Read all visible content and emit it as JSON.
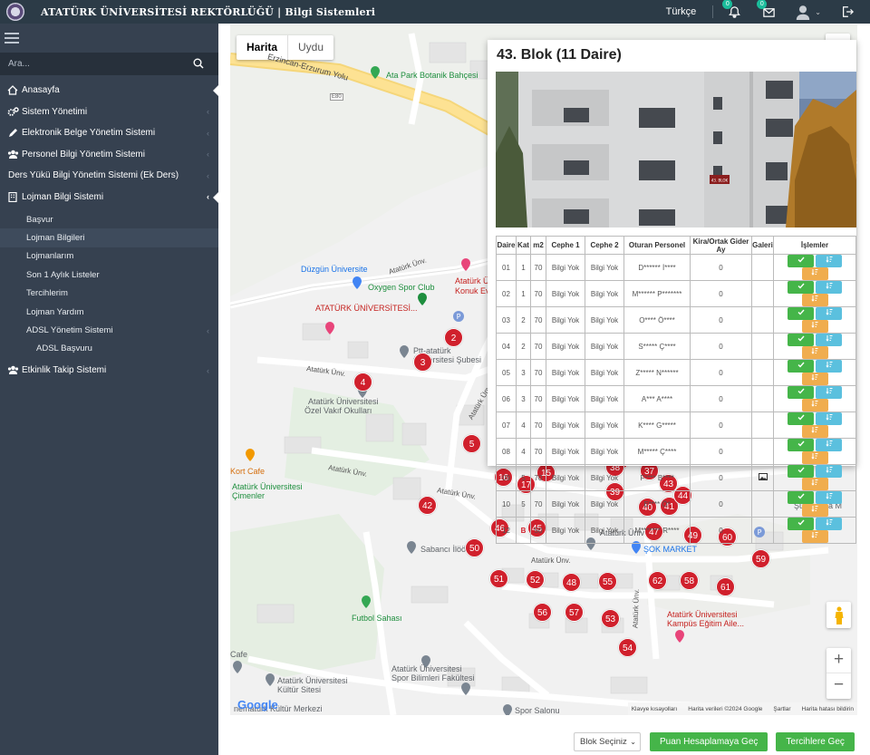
{
  "header": {
    "brand": "ATATÜRK ÜNİVERSİTESİ REKTÖRLÜĞÜ | Bilgi Sistemleri",
    "language": "Türkçe",
    "notifications_badge": "0",
    "messages_badge": "0"
  },
  "sidebar": {
    "search_placeholder": "Ara...",
    "items": [
      {
        "label": "Anasayfa",
        "icon": "home-icon"
      },
      {
        "label": "Sistem Yönetimi",
        "icon": "cogs-icon"
      },
      {
        "label": "Elektronik Belge Yönetim Sistemi",
        "icon": "pencil-icon"
      },
      {
        "label": "Personel Bilgi Yönetim Sistemi",
        "icon": "users-icon"
      },
      {
        "label": "Ders Yükü Bilgi Yönetim Sistemi (Ek Ders)",
        "icon": ""
      },
      {
        "label": "Lojman Bilgi Sistemi",
        "icon": "building-icon"
      }
    ],
    "subitems": [
      "Başvur",
      "Lojman Bilgileri",
      "Lojmanlarım",
      "Son 1 Aylık Listeler",
      "Tercihlerim",
      "Lojman Yardım",
      "ADSL Yönetim Sistemi",
      "ADSL Başvuru"
    ],
    "last_item": {
      "label": "Etkinlik Takip Sistemi",
      "icon": "users-icon"
    }
  },
  "map": {
    "type_map": "Harita",
    "type_satellite": "Uydu",
    "labels": {
      "highway": "Erzincan-Erzurum Yolu",
      "highway_code": "E80",
      "park": "Ata Park Botanik Bahçesi",
      "duzgun": "Düzgün Üniversite",
      "oxygen": "Oxygen Spor Club",
      "ataturk_uni": "ATATÜRK ÜNİVERSİTESİ...",
      "konuk1": "Atatürk Ün",
      "konuk2": "Konuk Evi",
      "ptt1": "Ptt-atatürk",
      "ptt2": "üniversitesi Şubesi",
      "vakif1": "Atatürk Üniversitesi",
      "vakif2": "Özel Vakıf Okulları",
      "kortcafe": "Kort Cafe",
      "cimenler1": "Atatürk Üniversitesi",
      "cimenler2": "Çimenler",
      "sabanci": "Sabancı İlöö",
      "universite": "Atatürk Üniversit",
      "sok": "ŞOK MARKET",
      "sukrupasa": "Şükrüpaşa M",
      "futbol": "Futbol Sahası",
      "kampus1": "Atatürk Üniversitesi",
      "kampus2": "Kampüs Eğitim Aile...",
      "cafe": "Cafe",
      "kultur1": "Atatürk Üniversitesi",
      "kultur2": "Kültür Sitesi",
      "spor1": "Atatürk Üniversitesi",
      "spor2": "Spor Bilimleri Fakültesi",
      "kulturmerkezi": "nematürk Kültür Merkezi",
      "sporsalonu": "Spor Salonu",
      "road": "Atatürk Ünv.",
      "road_v": "Atatürk Ünv."
    },
    "markers": [
      "2",
      "3",
      "4",
      "5",
      "15",
      "16",
      "17",
      "36",
      "37",
      "38",
      "39",
      "40",
      "41",
      "42",
      "43",
      "44",
      "46",
      "45",
      "47",
      "49",
      "50",
      "51",
      "52",
      "48",
      "55",
      "62",
      "58",
      "60",
      "59",
      "61",
      "56",
      "57",
      "53",
      "54"
    ],
    "google": "Google",
    "attribution": [
      "Klavye kısayolları",
      "Harita verileri ©2024 Google",
      "Şartlar",
      "Harita hatası bildirin"
    ]
  },
  "panel": {
    "title": "43. Blok (11 Daire)",
    "headers": [
      "Daire",
      "Kat",
      "m2",
      "Cephe 1",
      "Cephe 2",
      "Oturan Personel",
      "Kira/Ortak Gider Ay",
      "Galeri",
      "İşlemler"
    ],
    "rows": [
      {
        "daire": "01",
        "kat": "1",
        "m2": "70",
        "c1": "Bilgi Yok",
        "c2": "Bilgi Yok",
        "oturan": "D****** İ****",
        "kira": "0",
        "galeri": ""
      },
      {
        "daire": "02",
        "kat": "1",
        "m2": "70",
        "c1": "Bilgi Yok",
        "c2": "Bilgi Yok",
        "oturan": "M****** P*******",
        "kira": "0",
        "galeri": ""
      },
      {
        "daire": "03",
        "kat": "2",
        "m2": "70",
        "c1": "Bilgi Yok",
        "c2": "Bilgi Yok",
        "oturan": "O**** Ö****",
        "kira": "0",
        "galeri": ""
      },
      {
        "daire": "04",
        "kat": "2",
        "m2": "70",
        "c1": "Bilgi Yok",
        "c2": "Bilgi Yok",
        "oturan": "S***** Ç****",
        "kira": "0",
        "galeri": ""
      },
      {
        "daire": "05",
        "kat": "3",
        "m2": "70",
        "c1": "Bilgi Yok",
        "c2": "Bilgi Yok",
        "oturan": "Z***** N******",
        "kira": "0",
        "galeri": ""
      },
      {
        "daire": "06",
        "kat": "3",
        "m2": "70",
        "c1": "Bilgi Yok",
        "c2": "Bilgi Yok",
        "oturan": "A*** A****",
        "kira": "0",
        "galeri": ""
      },
      {
        "daire": "07",
        "kat": "4",
        "m2": "70",
        "c1": "Bilgi Yok",
        "c2": "Bilgi Yok",
        "oturan": "K**** G*****",
        "kira": "0",
        "galeri": ""
      },
      {
        "daire": "08",
        "kat": "4",
        "m2": "70",
        "c1": "Bilgi Yok",
        "c2": "Bilgi Yok",
        "oturan": "M***** Ç****",
        "kira": "0",
        "galeri": ""
      },
      {
        "daire": "09",
        "kat": "5",
        "m2": "70",
        "c1": "Bilgi Yok",
        "c2": "Bilgi Yok",
        "oturan": "F**** B****",
        "kira": "0",
        "galeri": "image-icon"
      },
      {
        "daire": "10",
        "kat": "5",
        "m2": "70",
        "c1": "Bilgi Yok",
        "c2": "Bilgi Yok",
        "oturan": "E**** Ö*",
        "kira": "0",
        "galeri": ""
      },
      {
        "daire": "12",
        "kat": "B",
        "m2": "50",
        "c1": "Bilgi Yok",
        "c2": "Bilgi Yok",
        "oturan": "M******* R****",
        "kira": "0",
        "galeri": ""
      }
    ],
    "sign_text": "43. BLOK"
  },
  "footer": {
    "select_value": "Blok Seçiniz",
    "button_score": "Puan Hesaplamaya Geç",
    "button_prefs": "Tercihlere Geç"
  },
  "colors": {
    "sidebar": "#364150",
    "topbar": "#2c3b47",
    "marker": "#d0202c",
    "success": "#45b549",
    "info": "#5bc0de",
    "warning": "#f0ad4e"
  }
}
